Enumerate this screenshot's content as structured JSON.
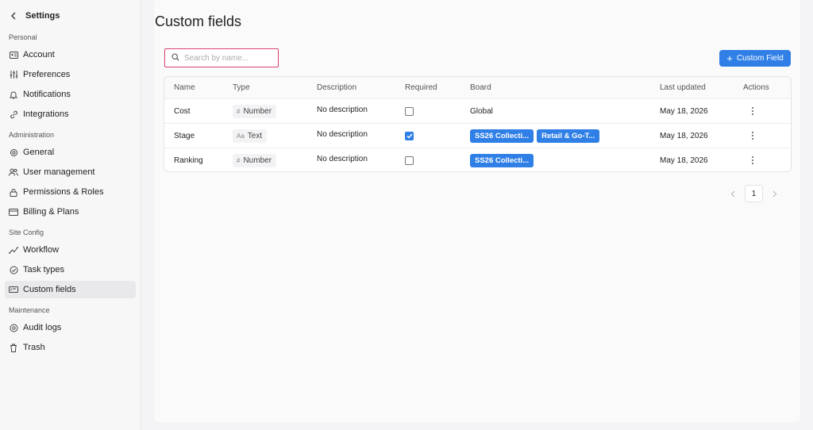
{
  "sidebar": {
    "title": "Settings",
    "sections": [
      {
        "label": "Personal",
        "items": [
          {
            "label": "Account",
            "icon": "id-card-icon"
          },
          {
            "label": "Preferences",
            "icon": "sliders-icon"
          },
          {
            "label": "Notifications",
            "icon": "bell-icon"
          },
          {
            "label": "Integrations",
            "icon": "link-icon"
          }
        ]
      },
      {
        "label": "Administration",
        "items": [
          {
            "label": "General",
            "icon": "gear-icon"
          },
          {
            "label": "User management",
            "icon": "users-icon"
          },
          {
            "label": "Permissions & Roles",
            "icon": "lock-icon"
          },
          {
            "label": "Billing & Plans",
            "icon": "credit-card-icon"
          }
        ]
      },
      {
        "label": "Site Config",
        "items": [
          {
            "label": "Workflow",
            "icon": "workflow-icon"
          },
          {
            "label": "Task types",
            "icon": "check-circle-icon"
          },
          {
            "label": "Custom fields",
            "icon": "custom-field-icon",
            "active": true
          }
        ]
      },
      {
        "label": "Maintenance",
        "items": [
          {
            "label": "Audit logs",
            "icon": "audit-icon"
          },
          {
            "label": "Trash",
            "icon": "trash-icon"
          }
        ]
      }
    ]
  },
  "main": {
    "title": "Custom fields",
    "search": {
      "placeholder": "Search by name...",
      "value": ""
    },
    "add_button": "Custom Field",
    "columns": [
      "Name",
      "Type",
      "Description",
      "Required",
      "Board",
      "Last updated",
      "Actions"
    ],
    "rows": [
      {
        "name": "Cost",
        "type": "Number",
        "type_icon": "#",
        "description": "No description",
        "required": false,
        "boards": [],
        "board_text": "Global",
        "updated": "May 18, 2026"
      },
      {
        "name": "Stage",
        "type": "Text",
        "type_icon": "Aa",
        "description": "No description",
        "required": true,
        "boards": [
          "SS26 Collecti...",
          "Retail & Go-T..."
        ],
        "board_text": "",
        "updated": "May 18, 2026"
      },
      {
        "name": "Ranking",
        "type": "Number",
        "type_icon": "#",
        "description": "No description",
        "required": false,
        "boards": [
          "SS26 Collecti..."
        ],
        "board_text": "",
        "updated": "May 18, 2026"
      }
    ],
    "pagination": {
      "current": "1"
    }
  },
  "colors": {
    "accent": "#2f7fe6",
    "search_border": "#d9436b"
  }
}
